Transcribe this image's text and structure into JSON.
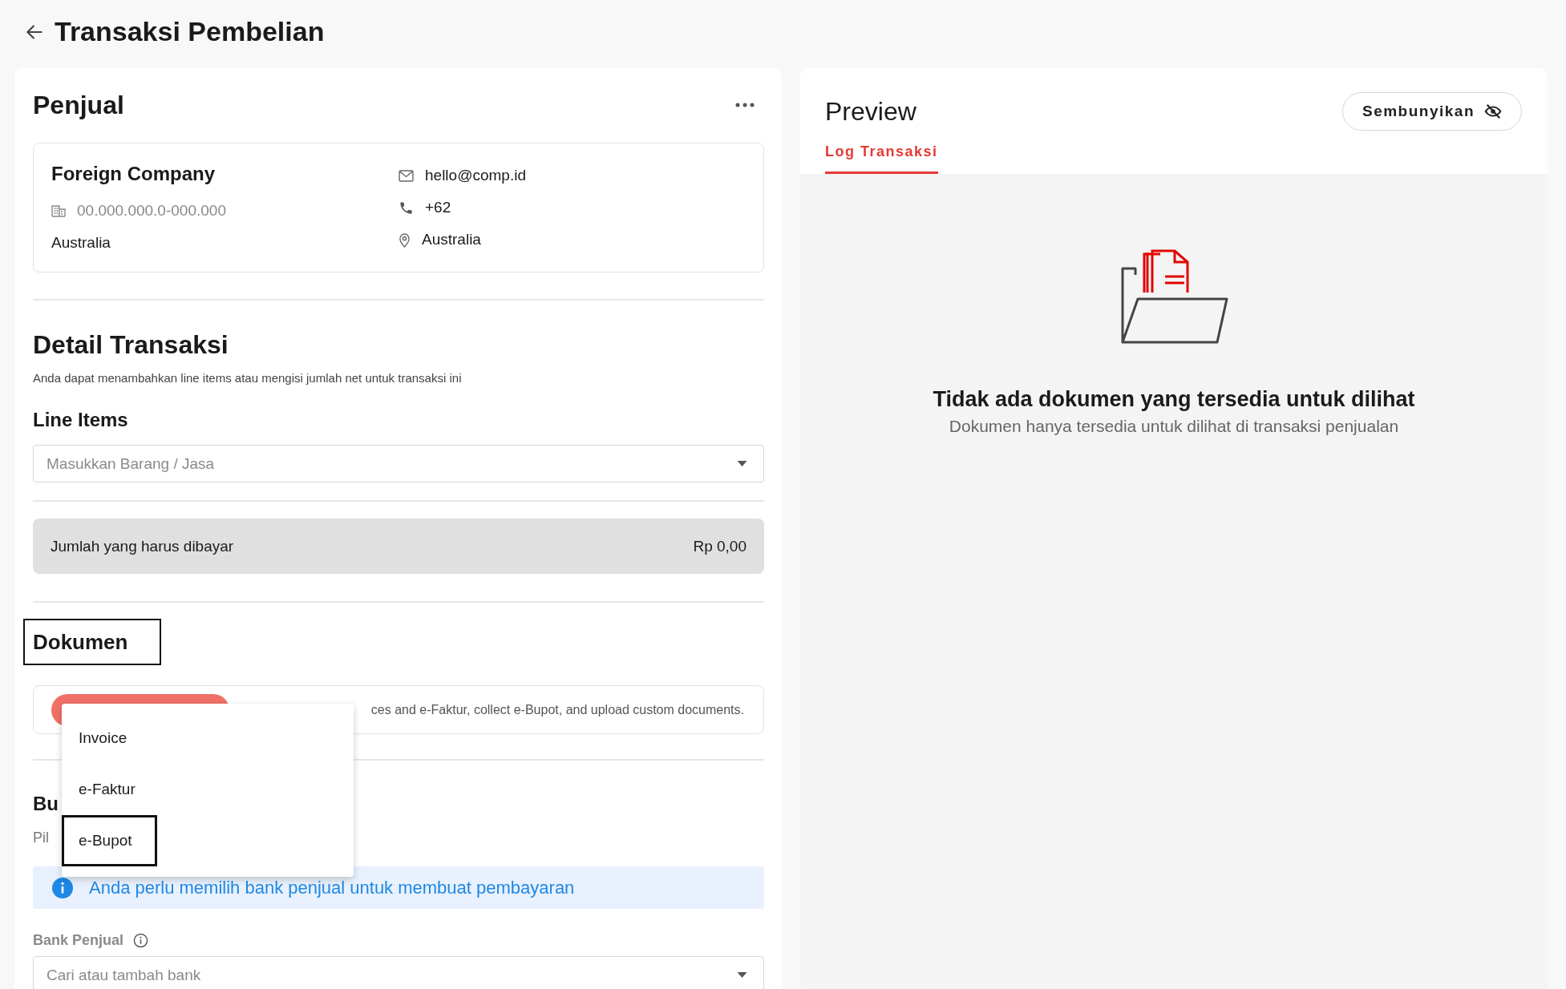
{
  "header": {
    "title": "Transaksi Pembelian"
  },
  "seller": {
    "title": "Penjual",
    "name": "Foreign Company",
    "tax_id": "00.000.000.0-000.000",
    "country": "Australia",
    "email": "hello@comp.id",
    "phone": "+62",
    "address": "Australia"
  },
  "detail": {
    "title": "Detail Transaksi",
    "description": "Anda dapat menambahkan line items atau mengisi jumlah net untuk transaksi ini",
    "line_items_label": "Line Items",
    "line_items_placeholder": "Masukkan Barang / Jasa",
    "total_label": "Jumlah yang harus dibayar",
    "total_value": "Rp 0,00"
  },
  "documents": {
    "title": "Dokumen",
    "focused": true,
    "description": "ces and e-Faktur, collect e-Bupot, and upload custom documents.",
    "menu": [
      {
        "label": "Invoice",
        "selected": false
      },
      {
        "label": "e-Faktur",
        "selected": false
      },
      {
        "label": "e-Bupot",
        "selected": true
      }
    ]
  },
  "bank": {
    "title": "Bu",
    "hint": "Pil",
    "notice": "Anda perlu memilih bank penjual untuk membuat pembayaran",
    "label": "Bank Penjual",
    "placeholder": "Cari atau tambah bank"
  },
  "preview": {
    "title": "Preview",
    "hide_button": "Sembunyikan",
    "tabs": [
      {
        "label": "Log Transaksi",
        "selected": true
      }
    ],
    "empty_title": "Tidak ada dokumen yang tersedia untuk dilihat",
    "empty_subtitle": "Dokumen hanya tersedia untuk dilihat di transaksi penjualan"
  }
}
